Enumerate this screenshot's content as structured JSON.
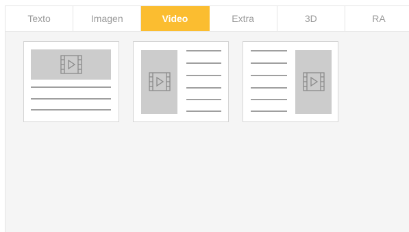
{
  "tabs": [
    {
      "label": "Texto",
      "active": false
    },
    {
      "label": "Imagen",
      "active": false
    },
    {
      "label": "Video",
      "active": true
    },
    {
      "label": "Extra",
      "active": false
    },
    {
      "label": "3D",
      "active": false
    },
    {
      "label": "RA",
      "active": false
    }
  ],
  "layouts": [
    {
      "name": "video-top-text-below",
      "icon": "video-icon"
    },
    {
      "name": "video-left-text-right",
      "icon": "video-icon"
    },
    {
      "name": "text-left-video-right",
      "icon": "video-icon"
    }
  ],
  "colors": {
    "accent": "#fbbd30",
    "placeholder": "#cccccc",
    "line": "#666666",
    "panel_bg": "#f5f5f5",
    "tab_text": "#9a9a9a"
  }
}
